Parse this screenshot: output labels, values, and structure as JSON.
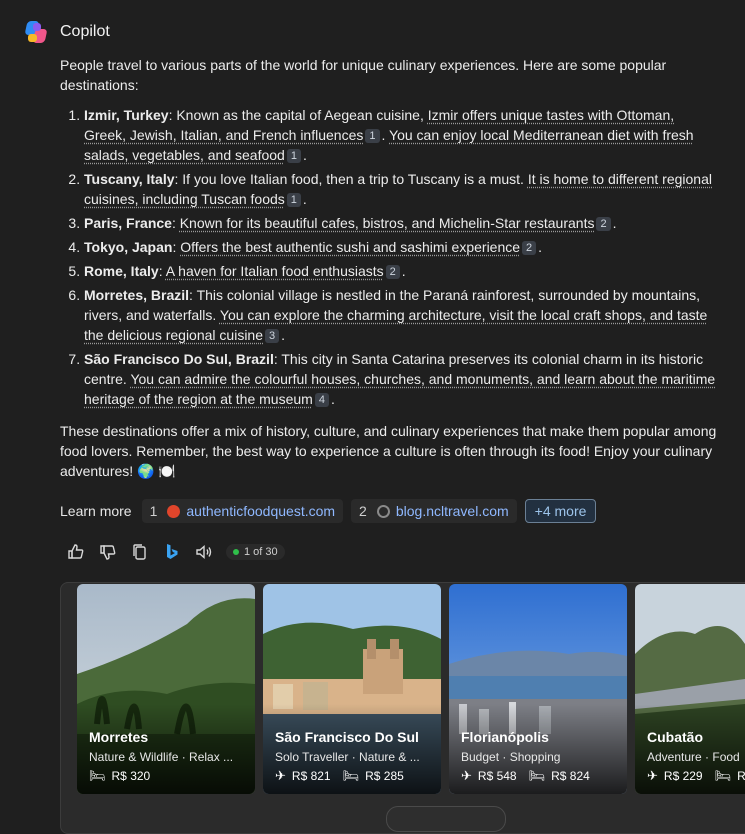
{
  "app": {
    "name": "Copilot"
  },
  "intro": "People travel to various parts of the world for unique culinary experiences. Here are some popular destinations:",
  "items": [
    {
      "bold": "Izmir, Turkey",
      "segments": [
        {
          "t": ": Known as the capital of Aegean cuisine, "
        },
        {
          "t": "Izmir offers unique tastes with Ottoman, Greek, Jewish, Italian, and French influences",
          "u": true
        },
        {
          "c": "1"
        },
        {
          "t": ". "
        },
        {
          "t": "You can enjoy local Mediterranean diet with fresh salads, vegetables, and seafood",
          "u": true
        },
        {
          "c": "1"
        },
        {
          "t": "."
        }
      ]
    },
    {
      "bold": "Tuscany, Italy",
      "segments": [
        {
          "t": ": If you love Italian food, then a trip to Tuscany is a must. "
        },
        {
          "t": "It is home to different regional cuisines, including Tuscan foods",
          "u": true
        },
        {
          "c": "1"
        },
        {
          "t": "."
        }
      ]
    },
    {
      "bold": "Paris, France",
      "segments": [
        {
          "t": ": "
        },
        {
          "t": "Known for its beautiful cafes, bistros, and Michelin-Star restaurants",
          "u": true
        },
        {
          "c": "2"
        },
        {
          "t": "."
        }
      ]
    },
    {
      "bold": "Tokyo, Japan",
      "segments": [
        {
          "t": ": "
        },
        {
          "t": "Offers the best authentic sushi and sashimi experience",
          "u": true
        },
        {
          "c": "2"
        },
        {
          "t": "."
        }
      ]
    },
    {
      "bold": "Rome, Italy",
      "segments": [
        {
          "t": ": "
        },
        {
          "t": "A haven for Italian food enthusiasts",
          "u": true
        },
        {
          "c": "2"
        },
        {
          "t": "."
        }
      ]
    },
    {
      "bold": "Morretes, Brazil",
      "segments": [
        {
          "t": ": This colonial village is nestled in the Paraná rainforest, surrounded by mountains, rivers, and waterfalls. "
        },
        {
          "t": "You can explore the charming architecture, visit the local craft shops, and taste the delicious regional cuisine",
          "u": true
        },
        {
          "c": "3"
        },
        {
          "t": "."
        }
      ]
    },
    {
      "bold": "São Francisco Do Sul, Brazil",
      "segments": [
        {
          "t": ": This city in Santa Catarina preserves its colonial charm in its historic centre. "
        },
        {
          "t": "You can admire the colourful houses, churches, and monuments, and learn about the maritime heritage of the region at the museum",
          "u": true
        },
        {
          "c": "4"
        },
        {
          "t": "."
        }
      ]
    }
  ],
  "outro": "These destinations offer a mix of history, culture, and culinary experiences that make them popular among food lovers. Remember, the best way to experience a culture is often through its food! Enjoy your culinary adventures! 🌍 🍽️",
  "learn_more": {
    "label": "Learn more",
    "sources": [
      {
        "num": "1",
        "domain": "authenticfoodquest.com",
        "icon": "site-favicon-red",
        "color": "#e0452b"
      },
      {
        "num": "2",
        "domain": "blog.ncltravel.com",
        "icon": "globe-icon",
        "color": "#8a8a8a"
      }
    ],
    "more_label": "+4 more"
  },
  "actions": {
    "counter": "1 of 30",
    "icons": [
      "thumbs-up-icon",
      "thumbs-down-icon",
      "copy-icon",
      "bing-icon",
      "speaker-icon"
    ]
  },
  "cards": [
    {
      "name": "Morretes",
      "tags": "Nature & Wildlife  ·  Relax ...",
      "prices": [
        {
          "icon": "hotel-icon",
          "glyph": "🛏",
          "value": "R$ 320"
        }
      ]
    },
    {
      "name": "São Francisco Do Sul",
      "tags": "Solo Traveller  ·  Nature & ...",
      "prices": [
        {
          "icon": "flight-icon",
          "glyph": "✈",
          "value": "R$ 821"
        },
        {
          "icon": "hotel-icon",
          "glyph": "🛏",
          "value": "R$ 285"
        }
      ]
    },
    {
      "name": "Florianópolis",
      "tags": "Budget  ·  Shopping",
      "prices": [
        {
          "icon": "flight-icon",
          "glyph": "✈",
          "value": "R$ 548"
        },
        {
          "icon": "hotel-icon",
          "glyph": "🛏",
          "value": "R$ 824"
        }
      ]
    },
    {
      "name": "Cubatão",
      "tags": "Adventure  ·  Food",
      "prices": [
        {
          "icon": "flight-icon",
          "glyph": "✈",
          "value": "R$ 229"
        },
        {
          "icon": "hotel-icon",
          "glyph": "🛏",
          "value": "R$"
        }
      ]
    }
  ]
}
